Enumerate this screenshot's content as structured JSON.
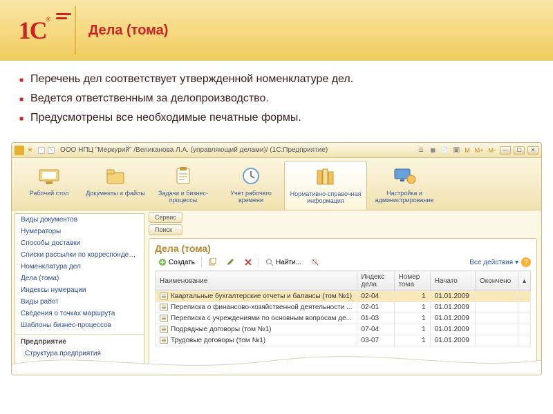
{
  "slide": {
    "title": "Дела (тома)",
    "bullets": [
      "Перечень дел соответствует утвержденной номенклатуре дел.",
      "Ведется ответственным за делопроизводство.",
      "Предусмотрены все необходимые печатные формы."
    ]
  },
  "app": {
    "titlebar": "ООО НПЦ \"Меркурий\" /Великанова Л.А. (управляющий делами)/  (1С:Предприятие)",
    "zoom": {
      "m": "M",
      "mplus": "M+",
      "mminus": "M-"
    }
  },
  "sections": [
    "Рабочий стол",
    "Документы и файлы",
    "Задачи и бизнес-процессы",
    "Учет рабочего времени",
    "Нормативно-справочная информация",
    "Настройка и администрирование"
  ],
  "sidebar": {
    "items": [
      "Виды документов",
      "Нумераторы",
      "Способы доставки",
      "Списки рассылки по корреспондентам",
      "Номенклатура дел",
      "Дела (тома)",
      "Индексы нумерации",
      "Виды работ",
      "Сведения о точках маршрута",
      "Шаблоны бизнес-процессов"
    ],
    "group_header": "Предприятие",
    "group_items": [
      "Структура предприятия"
    ]
  },
  "svc": {
    "service": "Сервис",
    "search": "Поиск"
  },
  "panel": {
    "title": "Дела (тома)",
    "create": "Создать",
    "find": "Найти...",
    "all_actions": "Все действия",
    "columns": [
      "Наименование",
      "Индекс дела",
      "Номер тома",
      "Начато",
      "Окончено"
    ],
    "rows": [
      {
        "name": "Квартальные бухгалтерские отчеты и балансы (том №1)",
        "index": "02-04",
        "num": "1",
        "start": "01.01.2009",
        "end": ""
      },
      {
        "name": "Переписка о финансово-хозяйственной деятельности ...",
        "index": "02-01",
        "num": "1",
        "start": "01.01.2009",
        "end": ""
      },
      {
        "name": "Переписка с учреждениями по основным вопросам де...",
        "index": "01-03",
        "num": "1",
        "start": "01.01.2009",
        "end": ""
      },
      {
        "name": "Подрядные договоры (том №1)",
        "index": "07-04",
        "num": "1",
        "start": "01.01.2009",
        "end": ""
      },
      {
        "name": "Трудовые договоры (том №1)",
        "index": "03-07",
        "num": "1",
        "start": "01.01.2009",
        "end": ""
      }
    ]
  }
}
